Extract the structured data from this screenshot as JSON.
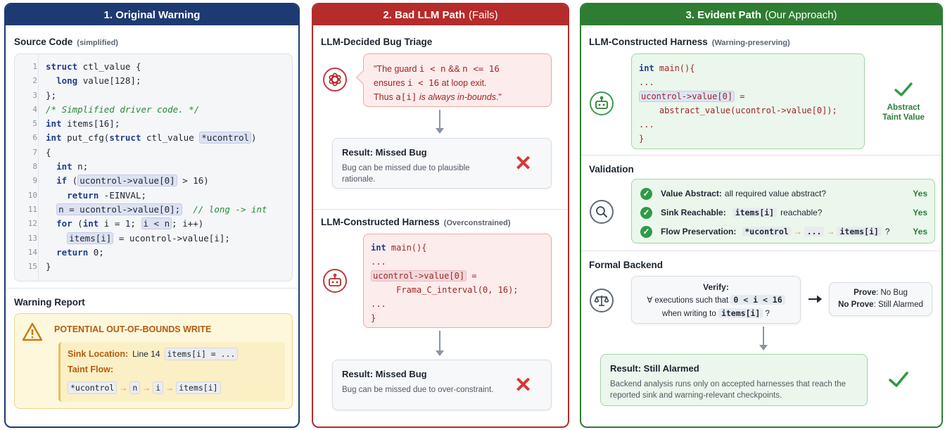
{
  "panel1": {
    "num": "1. Original Warning",
    "source_title": "Source Code",
    "source_sub": "(simplified)",
    "line_numbers": [
      "1",
      "2",
      "3",
      "4",
      "5",
      "6",
      "7",
      "8",
      "9",
      "10",
      "11",
      "12",
      "13",
      "14",
      "15"
    ],
    "warning_title": "Warning Report",
    "warning_heading": "POTENTIAL OUT-OF-BOUNDS WRITE",
    "sink_label": "Sink Location:",
    "sink_line": "Line 14",
    "sink_code": "items[i] = ...",
    "taint_label": "Taint Flow:",
    "taint_chain": [
      "*ucontrol",
      "n",
      "i",
      "items[i]"
    ],
    "taint_arrow": "→"
  },
  "panel2": {
    "num": "2. Bad LLM Path",
    "num_sub": "(Fails)",
    "triage_title": "LLM-Decided Bug Triage",
    "result1_title": "Result: Missed Bug",
    "result1_desc": "Bug can be missed due to plausible rationale.",
    "harness_title": "LLM-Constructed Harness",
    "harness_sub": "(Overconstrained)",
    "result2_title": "Result: Missed Bug",
    "result2_desc": "Bug can be missed due to over-constraint."
  },
  "panel3": {
    "num": "3. Evident Path",
    "num_sub": "(Our Approach)",
    "harness_title": "LLM-Constructed Harness",
    "harness_sub": "(Warning-preserving)",
    "abstract_label": "Abstract Taint Value",
    "validation_title": "Validation",
    "checks": [
      {
        "label": "Value Abstract:",
        "text": "all required value abstract?",
        "result": "Yes"
      },
      {
        "label": "Sink Reachable:",
        "code": "items[i]",
        "text": "reachable?",
        "result": "Yes"
      },
      {
        "label": "Flow Preservation:",
        "result": "Yes"
      }
    ],
    "flow": [
      "*ucontrol",
      "...",
      "items[i]"
    ],
    "flow_q": "?",
    "backend_title": "Formal Backend",
    "verify_label": "Verify:",
    "verify_line1_pre": "∀ executions such that",
    "verify_cond": "0 < i < 16",
    "verify_line2_pre": "when writing to",
    "verify_target": "items[i]",
    "verify_q": "?",
    "prove_label": "Prove",
    "prove_text": ": No Bug",
    "noprove_label": "No Prove",
    "noprove_text": ": Still Alarmed",
    "result_title": "Result: Still Alarmed",
    "result_desc": "Backend analysis runs only on accepted harnesses that reach the reported sink and warning-relevant checkpoints."
  },
  "colors": {
    "blue": "#1e3a72",
    "red": "#b62b2b",
    "green": "#2e7d32"
  }
}
